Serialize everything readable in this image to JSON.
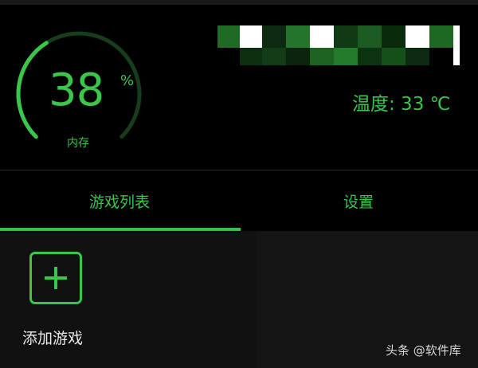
{
  "gauge": {
    "value": "38",
    "unit": "%",
    "label": "内存",
    "fraction": 0.38
  },
  "temperature": {
    "text": "温度: 33 ℃"
  },
  "tabs": [
    {
      "label": "游戏列表",
      "active": true
    },
    {
      "label": "设置",
      "active": false
    }
  ],
  "add_game": {
    "label": "添加游戏"
  },
  "watermark": {
    "text": "头条 @软件库"
  },
  "colors": {
    "accent": "#39c64a",
    "background": "#000000",
    "panel": "#111111",
    "track": "#173d1c"
  },
  "icons": {
    "add": "plus-icon"
  }
}
